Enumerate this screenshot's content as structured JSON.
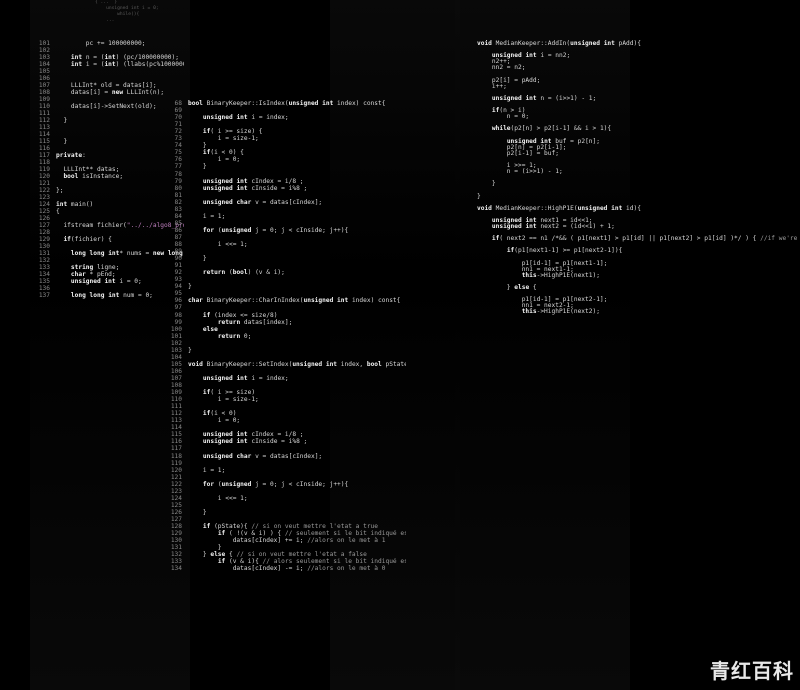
{
  "left_panel": {
    "lines": [
      {
        "ln": "101",
        "t": "        pc += 100000000;"
      },
      {
        "ln": "102",
        "t": ""
      },
      {
        "ln": "103",
        "t": "    int n = (int) (pc/100000000);"
      },
      {
        "ln": "104",
        "t": "    int i = (int) (llabs(pc%100000000));"
      },
      {
        "ln": "105",
        "t": ""
      },
      {
        "ln": "106",
        "t": ""
      },
      {
        "ln": "107",
        "t": "    LLLInt* old = datas[i];"
      },
      {
        "ln": "108",
        "t": "    datas[i] = new LLLInt(n);"
      },
      {
        "ln": "109",
        "t": ""
      },
      {
        "ln": "110",
        "t": "    datas[i]->SetNext(old);"
      },
      {
        "ln": "111",
        "t": ""
      },
      {
        "ln": "112",
        "t": "  }"
      },
      {
        "ln": "113",
        "t": ""
      },
      {
        "ln": "114",
        "t": ""
      },
      {
        "ln": "115",
        "t": "  }"
      },
      {
        "ln": "116",
        "t": ""
      },
      {
        "ln": "117",
        "t": "private:"
      },
      {
        "ln": "118",
        "t": ""
      },
      {
        "ln": "119",
        "t": "  LLLInt** datas;"
      },
      {
        "ln": "120",
        "t": "  bool isInstance;"
      },
      {
        "ln": "121",
        "t": ""
      },
      {
        "ln": "122",
        "t": "};"
      },
      {
        "ln": "123",
        "t": ""
      },
      {
        "ln": "124",
        "t": "int main()"
      },
      {
        "ln": "125",
        "t": "{"
      },
      {
        "ln": "126",
        "t": ""
      },
      {
        "ln": "127",
        "t": "  ifstream fichier(\"../../algo8_programme\")"
      },
      {
        "ln": "128",
        "t": ""
      },
      {
        "ln": "129",
        "t": "  if(fichier) {"
      },
      {
        "ln": "130",
        "t": ""
      },
      {
        "ln": "131",
        "t": "    long long int* nums = new long long"
      },
      {
        "ln": "132",
        "t": ""
      },
      {
        "ln": "133",
        "t": "    string ligne;"
      },
      {
        "ln": "134",
        "t": "    char * pEnd;"
      },
      {
        "ln": "135",
        "t": "    unsigned int i = 0;"
      },
      {
        "ln": "136",
        "t": ""
      },
      {
        "ln": "137",
        "t": "    long long int num = 0;"
      }
    ]
  },
  "center_panel": {
    "lines": [
      {
        "ln": "68",
        "t": "bool BinaryKeeper::IsIndex(unsigned int index) const{"
      },
      {
        "ln": "69",
        "t": ""
      },
      {
        "ln": "70",
        "t": "    unsigned int i = index;"
      },
      {
        "ln": "71",
        "t": ""
      },
      {
        "ln": "72",
        "t": "    if( i >= size) {"
      },
      {
        "ln": "73",
        "t": "        i = size-1;"
      },
      {
        "ln": "74",
        "t": "    }"
      },
      {
        "ln": "75",
        "t": "    if(i < 0) {"
      },
      {
        "ln": "76",
        "t": "        i = 0;"
      },
      {
        "ln": "77",
        "t": "    }"
      },
      {
        "ln": "78",
        "t": ""
      },
      {
        "ln": "79",
        "t": "    unsigned int cIndex = i/8 ;"
      },
      {
        "ln": "80",
        "t": "    unsigned int cInside = i%8 ;"
      },
      {
        "ln": "81",
        "t": ""
      },
      {
        "ln": "82",
        "t": "    unsigned char v = datas[cIndex];"
      },
      {
        "ln": "83",
        "t": ""
      },
      {
        "ln": "84",
        "t": "    i = 1;"
      },
      {
        "ln": "85",
        "t": ""
      },
      {
        "ln": "86",
        "t": "    for (unsigned j = 0; j < cInside; j++){"
      },
      {
        "ln": "87",
        "t": ""
      },
      {
        "ln": "88",
        "t": "        i <<= 1;"
      },
      {
        "ln": "89",
        "t": ""
      },
      {
        "ln": "90",
        "t": "    }"
      },
      {
        "ln": "91",
        "t": ""
      },
      {
        "ln": "92",
        "t": "    return (bool) (v & i);"
      },
      {
        "ln": "93",
        "t": ""
      },
      {
        "ln": "94",
        "t": "}"
      },
      {
        "ln": "95",
        "t": ""
      },
      {
        "ln": "96",
        "t": "char BinaryKeeper::CharInIndex(unsigned int index) const{"
      },
      {
        "ln": "97",
        "t": ""
      },
      {
        "ln": "98",
        "t": "    if (index <= size/8)"
      },
      {
        "ln": "99",
        "t": "        return datas[index];"
      },
      {
        "ln": "100",
        "t": "    else"
      },
      {
        "ln": "101",
        "t": "        return 0;"
      },
      {
        "ln": "102",
        "t": ""
      },
      {
        "ln": "103",
        "t": "}"
      },
      {
        "ln": "104",
        "t": ""
      },
      {
        "ln": "105",
        "t": "void BinaryKeeper::SetIndex(unsigned int index, bool pState) {"
      },
      {
        "ln": "106",
        "t": ""
      },
      {
        "ln": "107",
        "t": "    unsigned int i = index;"
      },
      {
        "ln": "108",
        "t": ""
      },
      {
        "ln": "109",
        "t": "    if( i >= size)"
      },
      {
        "ln": "110",
        "t": "        i = size-1;"
      },
      {
        "ln": "111",
        "t": ""
      },
      {
        "ln": "112",
        "t": "    if(i < 0)"
      },
      {
        "ln": "113",
        "t": "        i = 0;"
      },
      {
        "ln": "114",
        "t": ""
      },
      {
        "ln": "115",
        "t": "    unsigned int cIndex = i/8 ;"
      },
      {
        "ln": "116",
        "t": "    unsigned int cInside = i%8 ;"
      },
      {
        "ln": "117",
        "t": ""
      },
      {
        "ln": "118",
        "t": "    unsigned char v = datas[cIndex];"
      },
      {
        "ln": "119",
        "t": ""
      },
      {
        "ln": "120",
        "t": "    i = 1;"
      },
      {
        "ln": "121",
        "t": ""
      },
      {
        "ln": "122",
        "t": "    for (unsigned j = 0; j < cInside; j++){"
      },
      {
        "ln": "123",
        "t": ""
      },
      {
        "ln": "124",
        "t": "        i <<= 1;"
      },
      {
        "ln": "125",
        "t": ""
      },
      {
        "ln": "126",
        "t": "    }"
      },
      {
        "ln": "127",
        "t": ""
      },
      {
        "ln": "128",
        "t": "    if (pState){ // si on veut mettre l'etat a true"
      },
      {
        "ln": "129",
        "t": "        if ( !(v & i) ) { // seulement si le bit indiqué est 0"
      },
      {
        "ln": "130",
        "t": "            datas[cIndex] += i; //alors on le met à 1"
      },
      {
        "ln": "131",
        "t": "        }"
      },
      {
        "ln": "132",
        "t": "    } else { // si on veut mettre l'etat a false"
      },
      {
        "ln": "133",
        "t": "        if (v & i){ // alors seulement si le bit indiqué est 1"
      },
      {
        "ln": "134",
        "t": "            datas[cIndex] -= i; //alors on le met à 0"
      }
    ]
  },
  "right_panel": {
    "lines": [
      {
        "ln": "",
        "t": "void MedianKeeper::AddIn(unsigned int pAdd){"
      },
      {
        "ln": "",
        "t": ""
      },
      {
        "ln": "",
        "t": "    unsigned int i = nn2;"
      },
      {
        "ln": "",
        "t": "    n2++;"
      },
      {
        "ln": "",
        "t": "    nn2 = n2;"
      },
      {
        "ln": "",
        "t": ""
      },
      {
        "ln": "",
        "t": "    p2[i] = pAdd;"
      },
      {
        "ln": "",
        "t": "    i++;"
      },
      {
        "ln": "",
        "t": ""
      },
      {
        "ln": "",
        "t": "    unsigned int n = (i>>1) - 1;"
      },
      {
        "ln": "",
        "t": ""
      },
      {
        "ln": "",
        "t": "    if(n > i)"
      },
      {
        "ln": "",
        "t": "        n = 0;"
      },
      {
        "ln": "",
        "t": ""
      },
      {
        "ln": "",
        "t": "    while(p2[n] > p2[i-1] && i > 1){"
      },
      {
        "ln": "",
        "t": ""
      },
      {
        "ln": "",
        "t": "        unsigned int buf = p2[n];"
      },
      {
        "ln": "",
        "t": "        p2[n] = p2[i-1];"
      },
      {
        "ln": "",
        "t": "        p2[i-1] = buf;"
      },
      {
        "ln": "",
        "t": ""
      },
      {
        "ln": "",
        "t": "        i >>= 1;"
      },
      {
        "ln": "",
        "t": "        n = (i>>1) - 1;"
      },
      {
        "ln": "",
        "t": ""
      },
      {
        "ln": "",
        "t": "    }"
      },
      {
        "ln": "",
        "t": ""
      },
      {
        "ln": "",
        "t": "}"
      },
      {
        "ln": "",
        "t": ""
      },
      {
        "ln": "",
        "t": "void MedianKeeper::HighP1E(unsigned int id){"
      },
      {
        "ln": "",
        "t": ""
      },
      {
        "ln": "",
        "t": "    unsigned int next1 = id<<1;"
      },
      {
        "ln": "",
        "t": "    unsigned int next2 = (id<<1) + 1;"
      },
      {
        "ln": "",
        "t": ""
      },
      {
        "ln": "",
        "t": "    if( next2 == n1 /*&& ( p1[next1] > p1[id] || p1[next2] > p1[id] )*/ ) { //if we're not down the tree"
      },
      {
        "ln": "",
        "t": ""
      },
      {
        "ln": "",
        "t": "        if(p1[next1-1] >= p1[next2-1]){"
      },
      {
        "ln": "",
        "t": ""
      },
      {
        "ln": "",
        "t": "            p1[id-1] = p1[next1-1];"
      },
      {
        "ln": "",
        "t": "            nn1 = next1-1;"
      },
      {
        "ln": "",
        "t": "            this->HighP1E(next1);"
      },
      {
        "ln": "",
        "t": ""
      },
      {
        "ln": "",
        "t": "        } else {"
      },
      {
        "ln": "",
        "t": ""
      },
      {
        "ln": "",
        "t": "            p1[id-1] = p1[next2-1];"
      },
      {
        "ln": "",
        "t": "            nn1 = next2-1;"
      },
      {
        "ln": "",
        "t": "            this->HighP1E(next2);"
      }
    ]
  },
  "watermark": "青红百科"
}
